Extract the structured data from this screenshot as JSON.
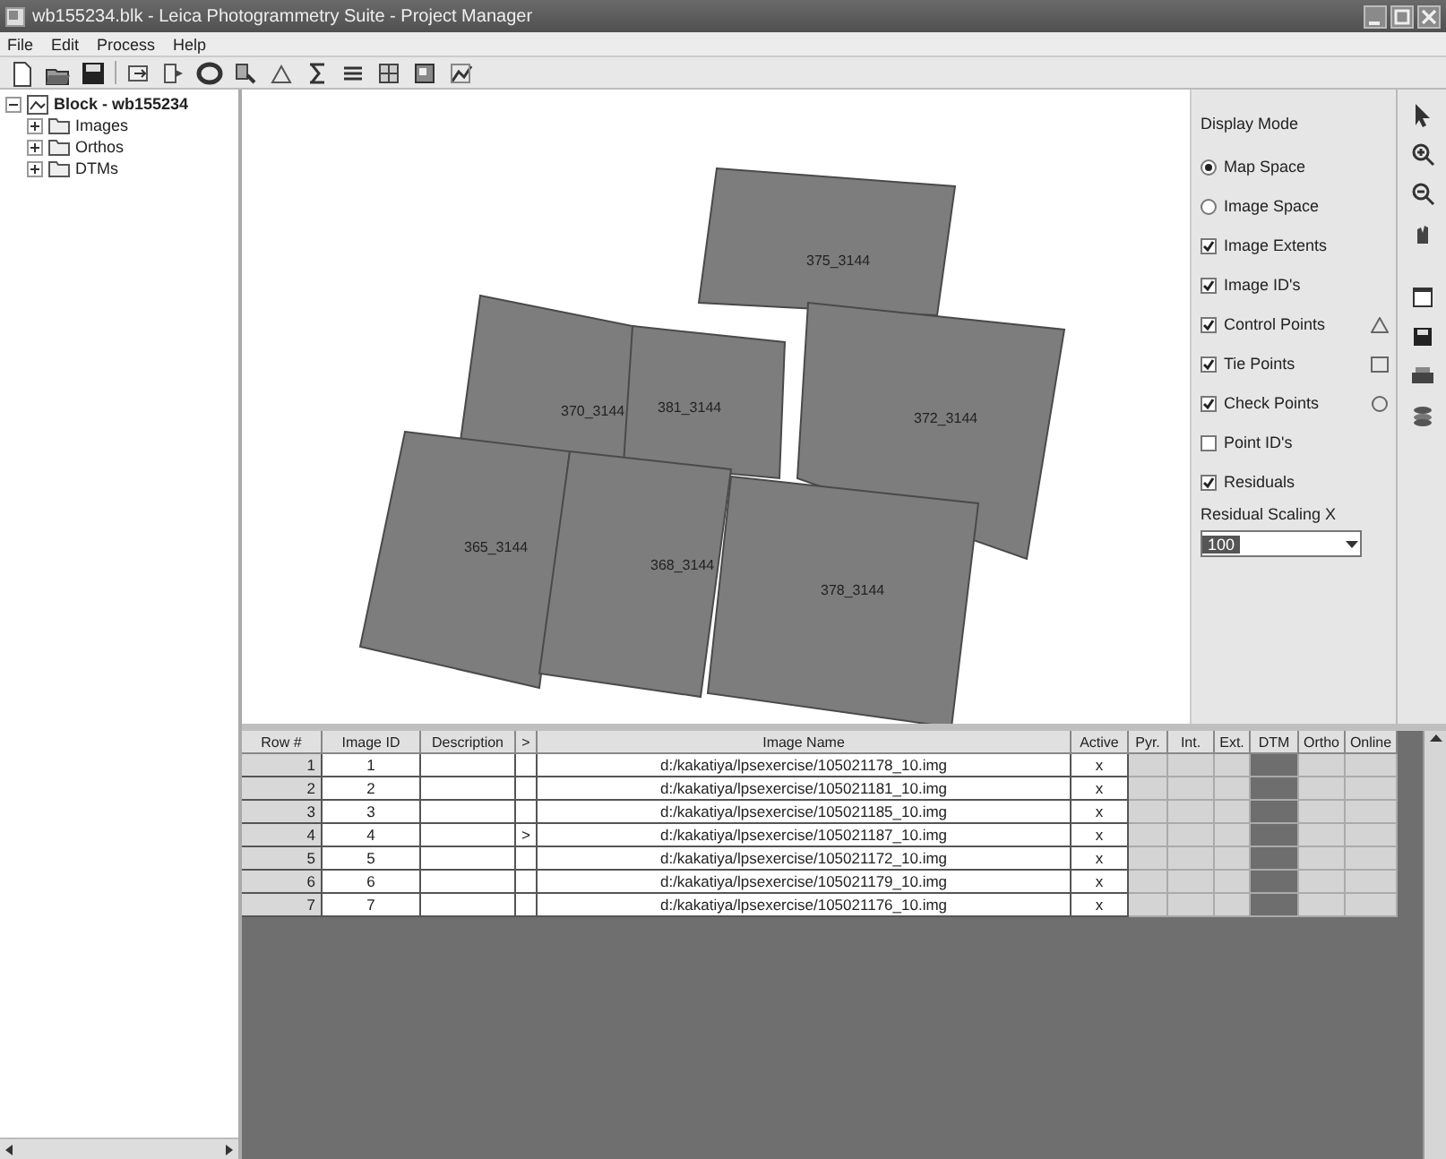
{
  "window": {
    "title": "wb155234.blk - Leica Photogrammetry Suite - Project Manager"
  },
  "menu": [
    "File",
    "Edit",
    "Process",
    "Help"
  ],
  "tree": {
    "label": "Block - wb155234",
    "expanded": true,
    "children": [
      {
        "label": "Images",
        "expanded": false
      },
      {
        "label": "Orthos",
        "expanded": false
      },
      {
        "label": "DTMs",
        "expanded": false
      }
    ]
  },
  "footprints": [
    {
      "label": "375_3144"
    },
    {
      "label": "372_3144"
    },
    {
      "label": "370_3144"
    },
    {
      "label": "381_3144"
    },
    {
      "label": "365_3144"
    },
    {
      "label": "368_3144"
    },
    {
      "label": "378_3144"
    }
  ],
  "display_panel": {
    "title": "Display Mode",
    "items": [
      {
        "kind": "radio",
        "label": "Map Space",
        "checked": true
      },
      {
        "kind": "radio",
        "label": "Image Space",
        "checked": false
      },
      {
        "kind": "checkbox",
        "label": "Image Extents",
        "checked": true
      },
      {
        "kind": "checkbox",
        "label": "Image ID's",
        "checked": true
      },
      {
        "kind": "checkbox",
        "label": "Control Points",
        "checked": true
      },
      {
        "kind": "checkbox",
        "label": "Tie Points",
        "checked": true
      },
      {
        "kind": "checkbox",
        "label": "Check Points",
        "checked": true
      },
      {
        "kind": "checkbox",
        "label": "Point ID's",
        "checked": false
      },
      {
        "kind": "checkbox",
        "label": "Residuals",
        "checked": true
      }
    ],
    "scaling_label": "Residual Scaling X",
    "scaling_value": "100"
  },
  "table": {
    "columns": [
      "Row #",
      "Image ID",
      "Description",
      ">",
      "Image Name",
      "Active",
      "Pyr.",
      "Int.",
      "Ext.",
      "DTM",
      "Ortho",
      "Online"
    ],
    "rows": [
      {
        "row": "1",
        "image_id": "1",
        "pointer": "",
        "name": "d:/kakatiya/lpsexercise/105021178_10.img",
        "active": "x",
        "status": [
          {
            "color": "#d4d4d4"
          },
          {
            "color": "#d4d4d4"
          },
          {
            "color": "#d4d4d4"
          },
          {
            "color": "#6e6e6e"
          },
          {
            "color": "#d4d4d4"
          },
          {
            "color": "#d4d4d4"
          }
        ]
      },
      {
        "row": "2",
        "image_id": "2",
        "pointer": "",
        "name": "d:/kakatiya/lpsexercise/105021181_10.img",
        "active": "x",
        "status": [
          {
            "color": "#d4d4d4"
          },
          {
            "color": "#d4d4d4"
          },
          {
            "color": "#d4d4d4"
          },
          {
            "color": "#6e6e6e"
          },
          {
            "color": "#d4d4d4"
          },
          {
            "color": "#d4d4d4"
          }
        ]
      },
      {
        "row": "3",
        "image_id": "3",
        "pointer": "",
        "name": "d:/kakatiya/lpsexercise/105021185_10.img",
        "active": "x",
        "status": [
          {
            "color": "#d4d4d4"
          },
          {
            "color": "#d4d4d4"
          },
          {
            "color": "#d4d4d4"
          },
          {
            "color": "#6e6e6e"
          },
          {
            "color": "#d4d4d4"
          },
          {
            "color": "#d4d4d4"
          }
        ]
      },
      {
        "row": "4",
        "image_id": "4",
        "pointer": ">",
        "name": "d:/kakatiya/lpsexercise/105021187_10.img",
        "active": "x",
        "status": [
          {
            "color": "#d4d4d4"
          },
          {
            "color": "#d4d4d4"
          },
          {
            "color": "#d4d4d4"
          },
          {
            "color": "#6e6e6e"
          },
          {
            "color": "#d4d4d4"
          },
          {
            "color": "#d4d4d4"
          }
        ]
      },
      {
        "row": "5",
        "image_id": "5",
        "pointer": "",
        "name": "d:/kakatiya/lpsexercise/105021172_10.img",
        "active": "x",
        "status": [
          {
            "color": "#d4d4d4"
          },
          {
            "color": "#d4d4d4"
          },
          {
            "color": "#d4d4d4"
          },
          {
            "color": "#6e6e6e"
          },
          {
            "color": "#d4d4d4"
          },
          {
            "color": "#d4d4d4"
          }
        ]
      },
      {
        "row": "6",
        "image_id": "6",
        "pointer": "",
        "name": "d:/kakatiya/lpsexercise/105021179_10.img",
        "active": "x",
        "status": [
          {
            "color": "#d4d4d4"
          },
          {
            "color": "#d4d4d4"
          },
          {
            "color": "#d4d4d4"
          },
          {
            "color": "#6e6e6e"
          },
          {
            "color": "#d4d4d4"
          },
          {
            "color": "#d4d4d4"
          }
        ]
      },
      {
        "row": "7",
        "image_id": "7",
        "pointer": "",
        "name": "d:/kakatiya/lpsexercise/105021176_10.img",
        "active": "x",
        "status": [
          {
            "color": "#d4d4d4"
          },
          {
            "color": "#d4d4d4"
          },
          {
            "color": "#d4d4d4"
          },
          {
            "color": "#6e6e6e"
          },
          {
            "color": "#d4d4d4"
          },
          {
            "color": "#d4d4d4"
          }
        ]
      }
    ]
  }
}
